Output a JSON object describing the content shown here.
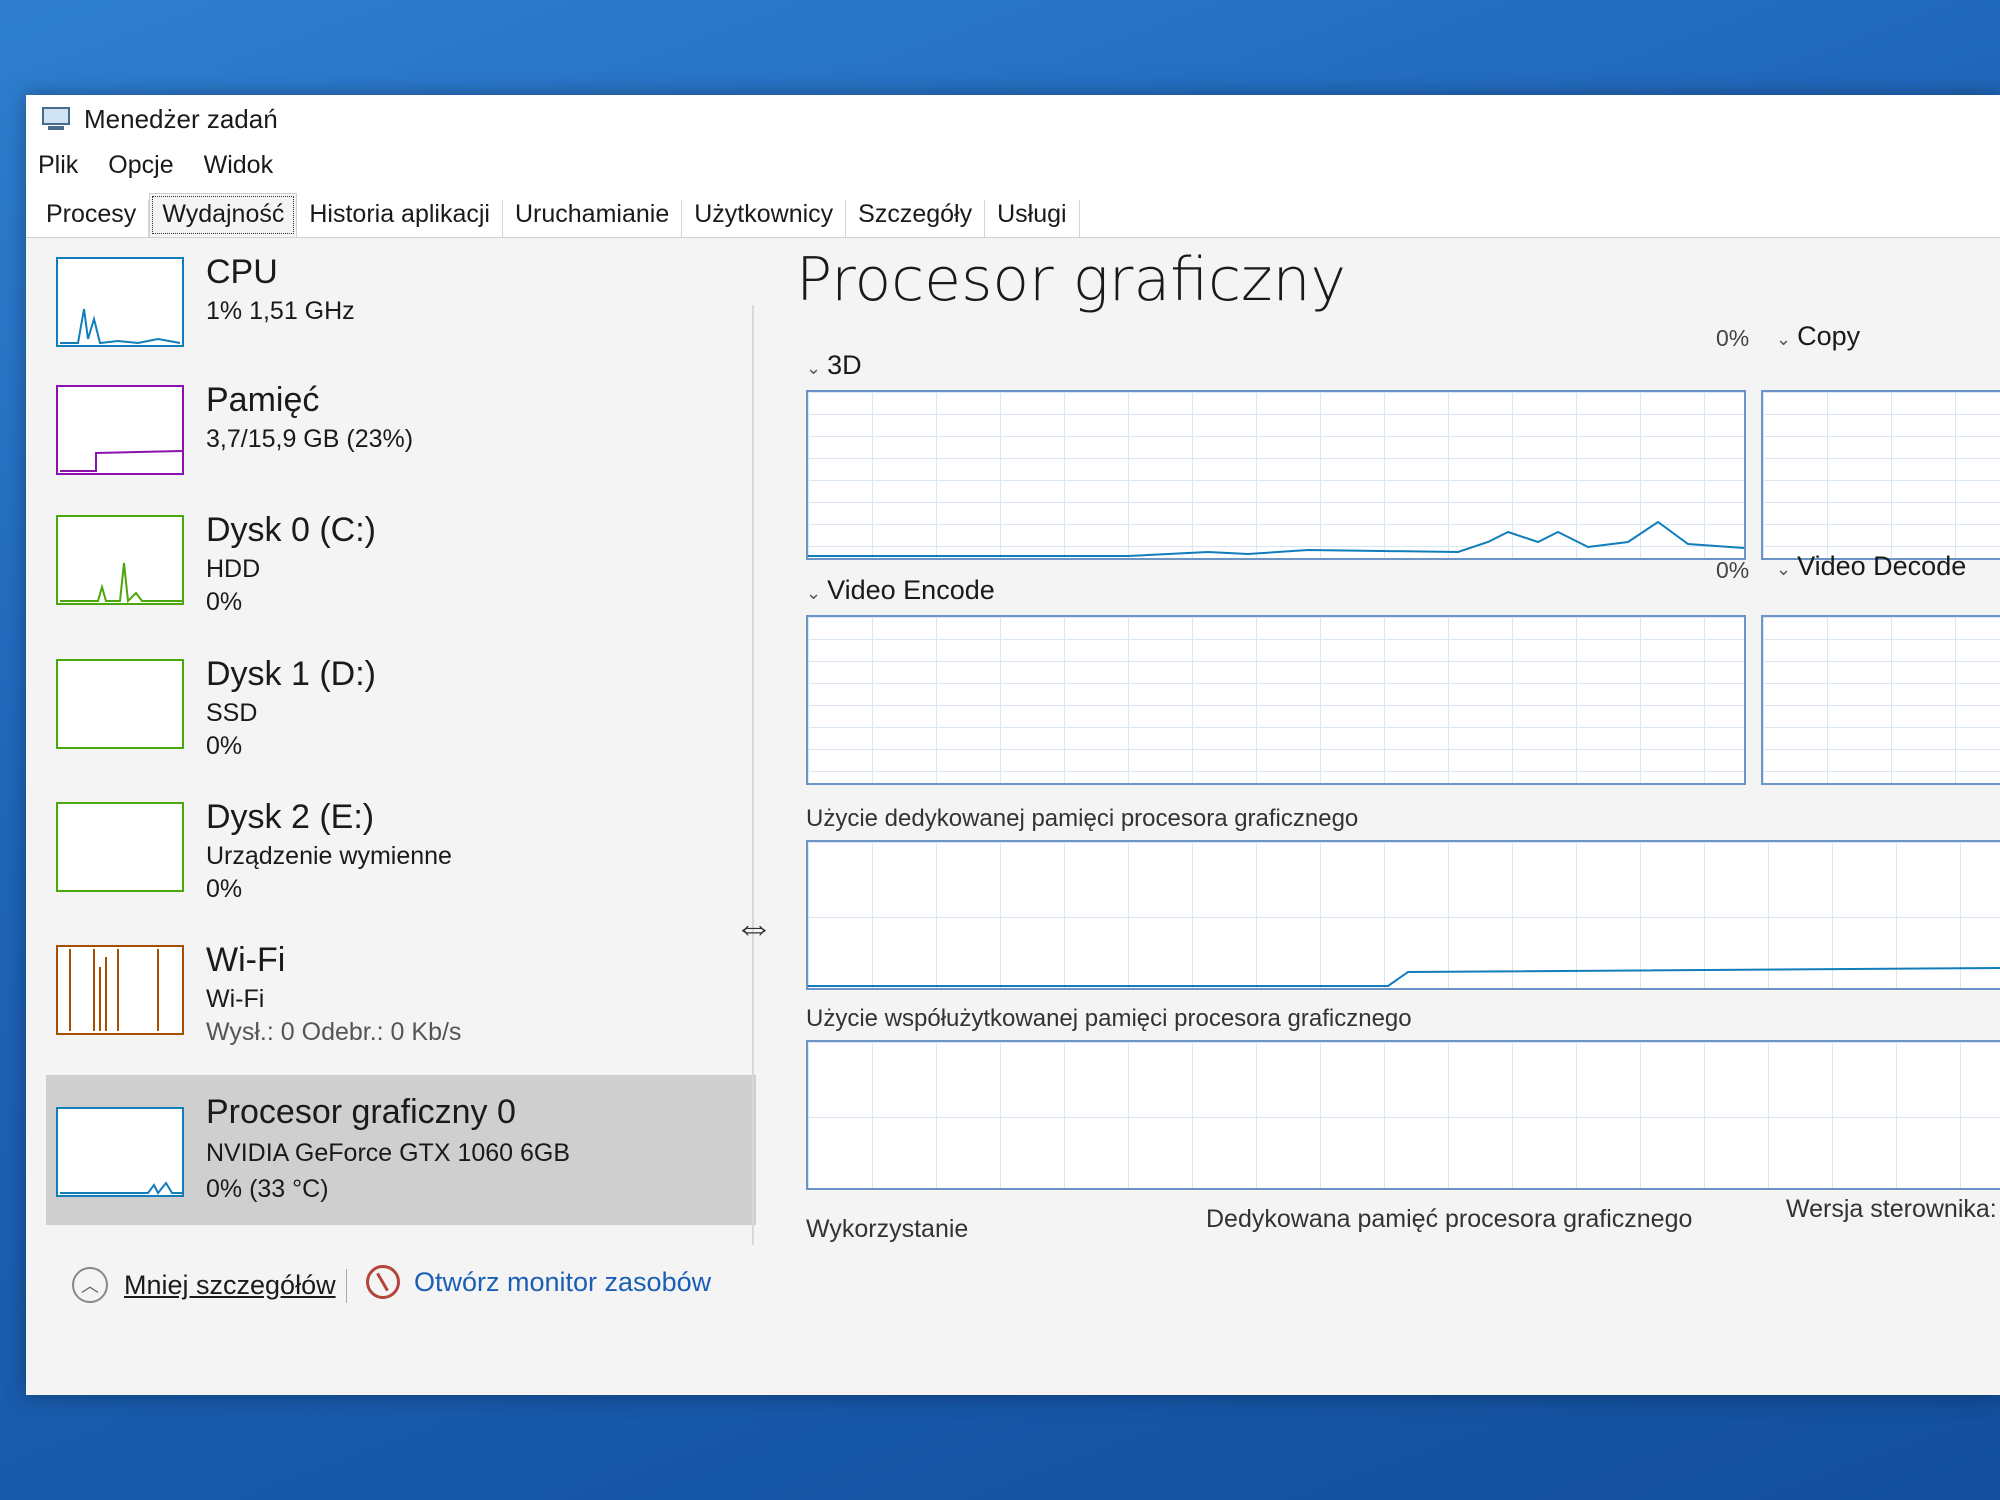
{
  "window": {
    "title": "Menedżer zadań"
  },
  "menu": [
    "Plik",
    "Opcje",
    "Widok"
  ],
  "tabs": [
    "Procesy",
    "Wydajność",
    "Historia aplikacji",
    "Uruchamianie",
    "Użytkownicy",
    "Szczegóły",
    "Usługi"
  ],
  "active_tab": "Wydajność",
  "sidebar": {
    "items": [
      {
        "name": "CPU",
        "line2": "1% 1,51 GHz",
        "line3": "",
        "icon": "cpu-graph",
        "color": "#117dbb"
      },
      {
        "name": "Pamięć",
        "line2": "3,7/15,9 GB (23%)",
        "line3": "",
        "icon": "memory-graph",
        "color": "#8b12ae"
      },
      {
        "name": "Dysk 0 (C:)",
        "line2": "HDD",
        "line3": "0%",
        "icon": "disk-graph",
        "color": "#4da60c"
      },
      {
        "name": "Dysk 1 (D:)",
        "line2": "SSD",
        "line3": "0%",
        "icon": "disk-graph",
        "color": "#4da60c"
      },
      {
        "name": "Dysk 2 (E:)",
        "line2": "Urządzenie wymienne",
        "line3": "0%",
        "icon": "disk-graph",
        "color": "#4da60c"
      },
      {
        "name": "Wi-Fi",
        "line2": "Wi-Fi",
        "line3": "Wysł.: 0 Odebr.: 0 Kb/s",
        "icon": "network-graph",
        "color": "#a74f01"
      },
      {
        "name": "Procesor graficzny 0",
        "line2": "NVIDIA GeForce GTX 1060 6GB",
        "line3": "0% (33 °C)",
        "icon": "gpu-graph",
        "color": "#117dbb"
      }
    ]
  },
  "main": {
    "title": "Procesor graficzny",
    "engines": [
      {
        "label": "3D",
        "percent": ""
      },
      {
        "label": "Copy",
        "percent": "0%"
      },
      {
        "label": "Video Encode",
        "percent": ""
      },
      {
        "label": "Video Decode",
        "percent": "0%"
      }
    ],
    "dedicated_memory_label": "Użycie dedykowanej pamięci procesora graficznego",
    "shared_memory_label": "Użycie współużytkowanej pamięci procesora graficznego",
    "stats": {
      "utilization_label": "Wykorzystanie",
      "dedicated_label": "Dedykowana pamięć procesora graficznego",
      "driver_label": "Wersja sterownika:"
    }
  },
  "footer": {
    "less_details": "Mniej szczegółów",
    "open_monitor": "Otwórz monitor zasobów"
  },
  "colors": {
    "graph_border": "#6c94c6",
    "selected_bg": "#cfcfcf",
    "link": "#1a5fb4"
  }
}
